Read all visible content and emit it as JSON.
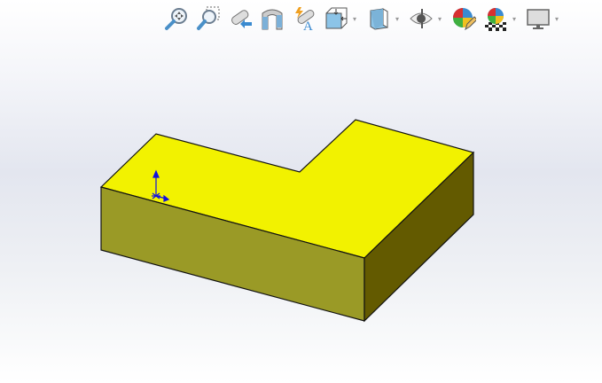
{
  "toolbar": {
    "items": [
      {
        "icon": "zoom-to-fit-icon"
      },
      {
        "icon": "zoom-to-area-icon"
      },
      {
        "icon": "previous-view-icon"
      },
      {
        "icon": "section-view-icon"
      },
      {
        "icon": "dynamic-annotation-views-icon"
      },
      {
        "icon": "view-orientation-icon",
        "dropdown": true
      },
      {
        "icon": "display-style-icon",
        "dropdown": true
      },
      {
        "icon": "hide-show-items-icon",
        "dropdown": true
      },
      {
        "icon": "edit-appearance-icon"
      },
      {
        "icon": "apply-scene-icon",
        "dropdown": true
      },
      {
        "icon": "view-settings-icon",
        "dropdown": true
      }
    ],
    "dropdown_glyph": "▾"
  },
  "model": {
    "top_color": "#f2f200",
    "front_color": "#9a9a26",
    "side_color": "#635a00",
    "edge_color": "#111111",
    "triad_color": "#1010e0"
  }
}
